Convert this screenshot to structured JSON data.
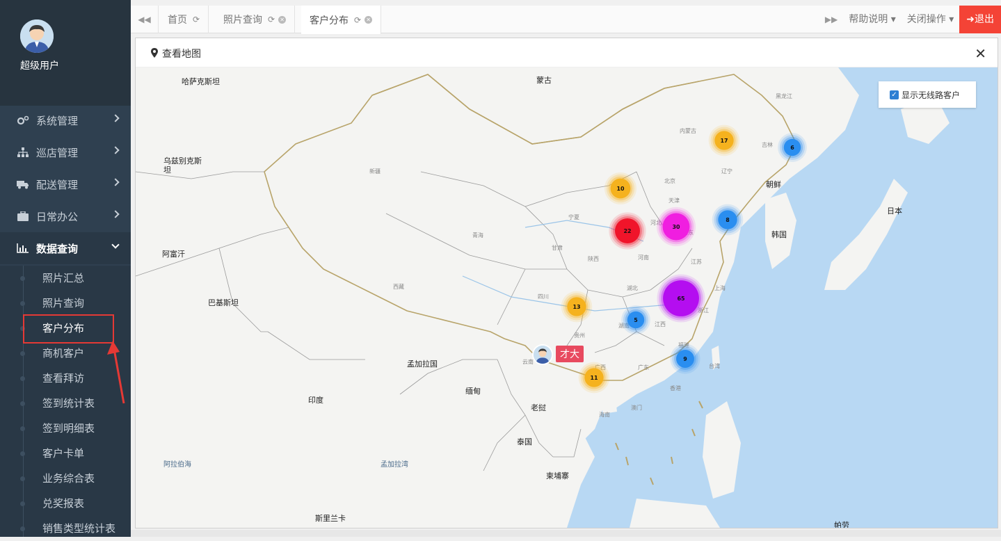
{
  "profile": {
    "name": "超级用户"
  },
  "menu": [
    {
      "label": "系统管理",
      "icon": "gears-icon"
    },
    {
      "label": "巡店管理",
      "icon": "sitemap-icon"
    },
    {
      "label": "配送管理",
      "icon": "truck-icon"
    },
    {
      "label": "日常办公",
      "icon": "briefcase-icon"
    },
    {
      "label": "数据查询",
      "icon": "bar-chart-icon",
      "expanded": true
    }
  ],
  "submenu": [
    "照片汇总",
    "照片查询",
    "客户分布",
    "商机客户",
    "查看拜访",
    "签到统计表",
    "签到明细表",
    "客户卡单",
    "业务综合表",
    "兑奖报表",
    "销售类型统计表"
  ],
  "tabs": [
    {
      "label": "首页"
    },
    {
      "label": "照片查询"
    },
    {
      "label": "客户分布",
      "active": true
    }
  ],
  "tools": {
    "help": "帮助说明",
    "close_ops": "关闭操作",
    "logout": "退出"
  },
  "panel": {
    "title": "查看地图"
  },
  "map": {
    "checkbox_label": "显示无线路客户",
    "user_label": "才大",
    "places": {
      "kazakhstan": "哈萨克斯坦",
      "mongolia": "蒙古",
      "uzbekistan": "乌兹别克斯坦",
      "afghanistan": "阿富汗",
      "pakistan": "巴基斯坦",
      "india": "印度",
      "bangladesh": "孟加拉国",
      "myanmar": "缅甸",
      "laos": "老挝",
      "thailand": "泰国",
      "cambodia": "柬埔寨",
      "srilanka": "斯里兰卡",
      "north_korea": "朝鲜",
      "south_korea": "韩国",
      "japan": "日本",
      "arabian_sea": "阿拉伯海",
      "bay_of_bengal": "孟加拉湾",
      "heilongjiang": "黑龙江",
      "neimenggu": "内蒙古",
      "jilin": "吉林",
      "liaoning": "辽宁",
      "xinjiang": "新疆",
      "qinghai": "青海",
      "xizang": "西藏",
      "sichuan": "四川",
      "gansu": "甘肃",
      "ningxia": "宁夏",
      "shaanxi": "陕西",
      "henan": "河南",
      "hubei": "湖北",
      "hunan": "湖南",
      "jiangxi": "江西",
      "jiangsu": "江苏",
      "zhejiang": "浙江",
      "shanghai": "上海",
      "fujian": "福建",
      "taiwan": "台湾",
      "guangdong": "广东",
      "guangxi": "广西",
      "guizhou": "贵州",
      "yunnan": "云南",
      "hainan": "海南",
      "xianggang": "香港",
      "aomen": "澳门",
      "beijing": "北京",
      "tianjin": "天津",
      "hebei": "河北",
      "shandong": "山东",
      "philippines": "帕劳"
    },
    "clusters": [
      {
        "count": "17",
        "color": "#f5b21e"
      },
      {
        "count": "6",
        "color": "#2a8ef0"
      },
      {
        "count": "10",
        "color": "#f5b21e"
      },
      {
        "count": "22",
        "color": "#f0142a"
      },
      {
        "count": "30",
        "color": "#f01ee0"
      },
      {
        "count": "8",
        "color": "#2a8ef0"
      },
      {
        "count": "65",
        "color": "#b40ef0"
      },
      {
        "count": "13",
        "color": "#f5b21e"
      },
      {
        "count": "5",
        "color": "#2a8ef0"
      },
      {
        "count": "9",
        "color": "#2a8ef0"
      },
      {
        "count": "11",
        "color": "#f5b21e"
      }
    ]
  }
}
